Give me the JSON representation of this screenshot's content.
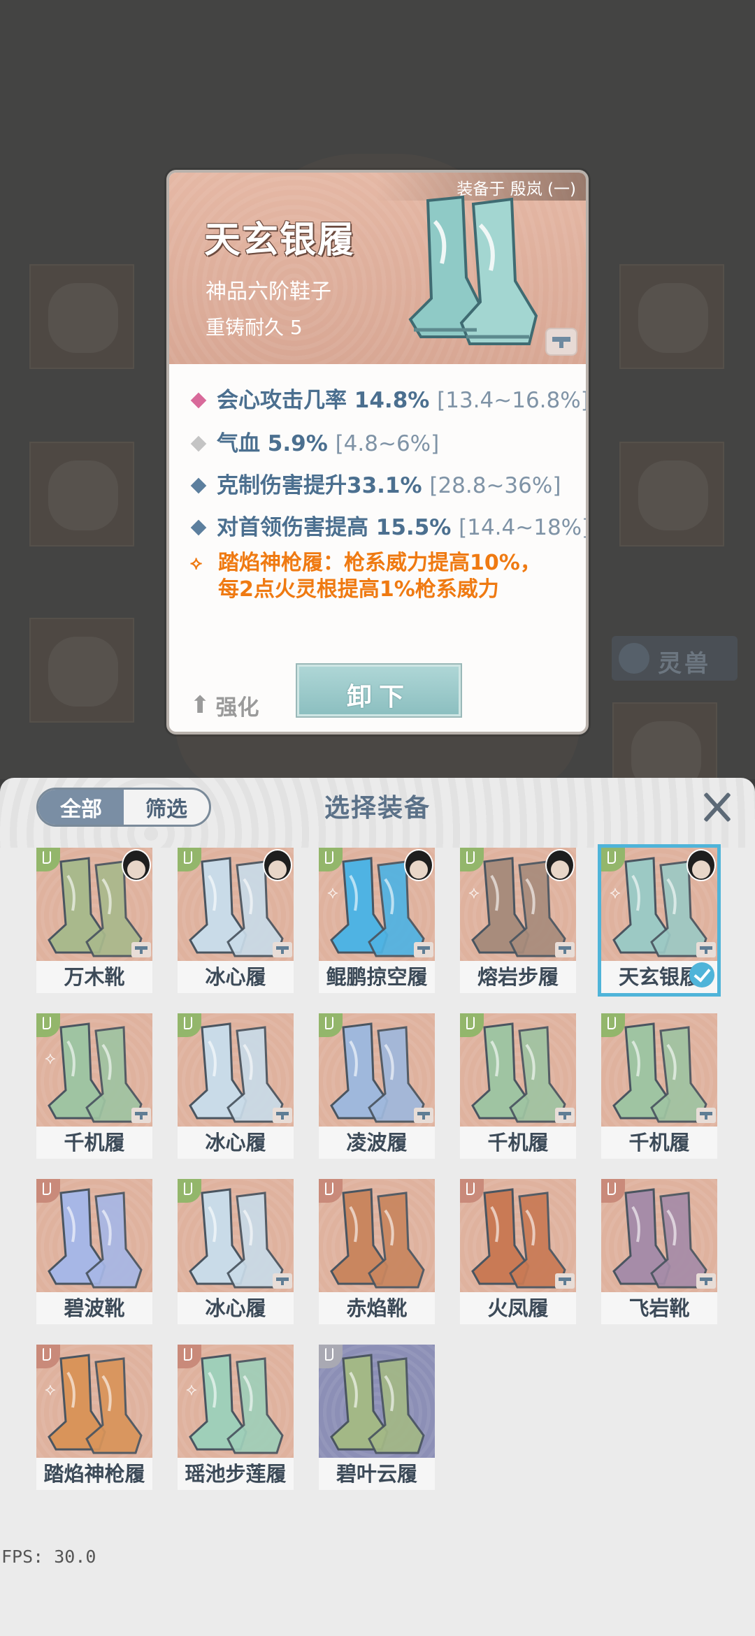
{
  "detail": {
    "equipped_on": "装备于 殷岚 (一)",
    "name": "天玄银履",
    "grade": "神品六阶鞋子",
    "durability": "重铸耐久 5",
    "stats": [
      {
        "label": "会心攻击几率 14.8%",
        "range": "[13.4~16.8%]",
        "color": "#d86a9a"
      },
      {
        "label": "气血 5.9%",
        "range": "[4.8~6%]",
        "color": "#c4c4c4"
      },
      {
        "label": "克制伤害提升33.1%",
        "range": "[28.8~36%]",
        "color": "#5c7f9e"
      },
      {
        "label": "对首领伤害提高 15.5%",
        "range": "[14.4~18%]",
        "color": "#5c7f9e"
      }
    ],
    "set_effect_line1": "踏焰神枪履：枪系威力提高10%，",
    "set_effect_line2": "每2点火灵根提高1%枪系威力",
    "enhance_label": "强化",
    "unequip_label": "卸下"
  },
  "background": {
    "spirit_beast_label": "灵兽"
  },
  "panel": {
    "tab_all": "全部",
    "tab_filter": "筛选",
    "title": "选择装备"
  },
  "items": [
    {
      "name": "万木靴",
      "corner": "green",
      "palette": "#a9b98c"
    },
    {
      "name": "冰心履",
      "corner": "green",
      "palette": "#c9dbe8"
    },
    {
      "name": "鲲鹏掠空履",
      "corner": "green",
      "palette": "#4fb3e3"
    },
    {
      "name": "熔岩步履",
      "corner": "green",
      "palette": "#a88c7c"
    },
    {
      "name": "天玄银履",
      "corner": "green",
      "palette": "#9cc9c4"
    },
    {
      "name": "千机履",
      "corner": "green",
      "palette": "#9fc4a2"
    },
    {
      "name": "冰心履",
      "corner": "green",
      "palette": "#c9dbe8"
    },
    {
      "name": "凌波履",
      "corner": "green",
      "palette": "#9fb8dc"
    },
    {
      "name": "千机履",
      "corner": "green",
      "palette": "#9fc4a2"
    },
    {
      "name": "千机履",
      "corner": "green",
      "palette": "#9fc4a2"
    },
    {
      "name": "碧波靴",
      "corner": "red",
      "palette": "#a7b7e6"
    },
    {
      "name": "冰心履",
      "corner": "green",
      "palette": "#c9dbe8"
    },
    {
      "name": "赤焰靴",
      "corner": "red",
      "palette": "#c9865f"
    },
    {
      "name": "火凤履",
      "corner": "red",
      "palette": "#c97a55"
    },
    {
      "name": "飞岩靴",
      "corner": "red",
      "palette": "#a68ca8"
    },
    {
      "name": "踏焰神枪履",
      "corner": "red",
      "palette": "#d9945a"
    },
    {
      "name": "瑶池步莲履",
      "corner": "red",
      "palette": "#9fcfb9"
    },
    {
      "name": "碧叶云履",
      "corner": "gray",
      "palette": "#a3b886"
    }
  ],
  "fps": "FPS: 30.0"
}
